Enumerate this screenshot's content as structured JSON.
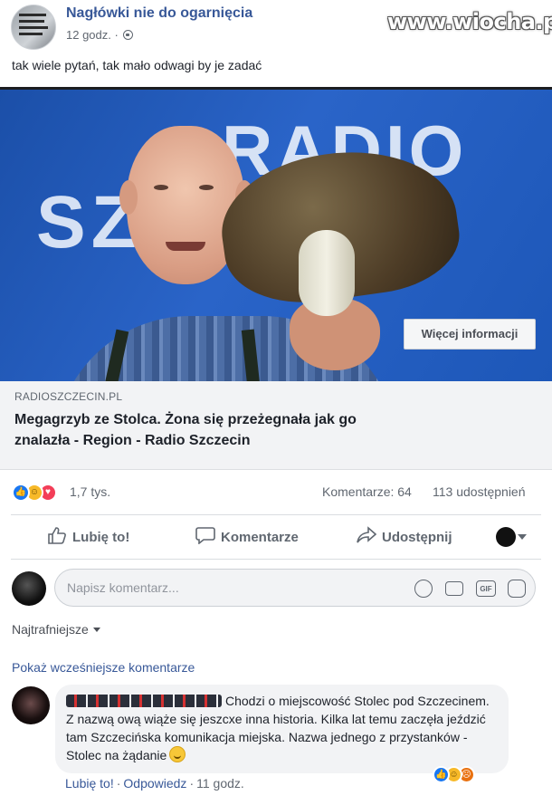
{
  "post": {
    "page_name": "Nagłówki nie do ogarnięcia",
    "time": "12 godz.",
    "middle_dot": "·",
    "text": "tak wiele pytań, tak mało odwagi by je zadać",
    "watermark": "www.wiocha.pl"
  },
  "image": {
    "radio_lines": [
      "RADIO",
      "SZCZECIN"
    ]
  },
  "link": {
    "domain": "RADIOSZCZECIN.PL",
    "title": "Megagrzyb ze Stolca. Żona się przeżegnała jak go znalazła - Region - Radio Szczecin",
    "button": "Więcej informacji"
  },
  "stats": {
    "reactions": "1,7 tys.",
    "comments": "Komentarze: 64",
    "shares": "113 udostępnień"
  },
  "actions": {
    "like": "Lubię to!",
    "comment": "Komentarze",
    "share": "Udostępnij"
  },
  "composer": {
    "placeholder": "Napisz komentarz...",
    "gif_label": "GIF"
  },
  "comments_section": {
    "sort": "Najtrafniejsze",
    "prev_link": "Pokaż wcześniejsze komentarze",
    "comment": {
      "text": "Chodzi o miejscowość Stolec pod Szczecinem. Z nazwą ową wiąże się jeszcxe inna historia. Kilka lat temu zaczęła jeździć tam Szczecińska komunikacja miejska. Nazwa jednego z przystanków - Stolec na żądanie",
      "like": "Lubię to!",
      "reply": "Odpowiedz",
      "time": "11 godz.",
      "sep": "·"
    }
  },
  "colors": {
    "brand_link": "#385898",
    "like_blue": "#1877f2",
    "love_red": "#f33e58",
    "haha_yellow": "#f7b928"
  }
}
